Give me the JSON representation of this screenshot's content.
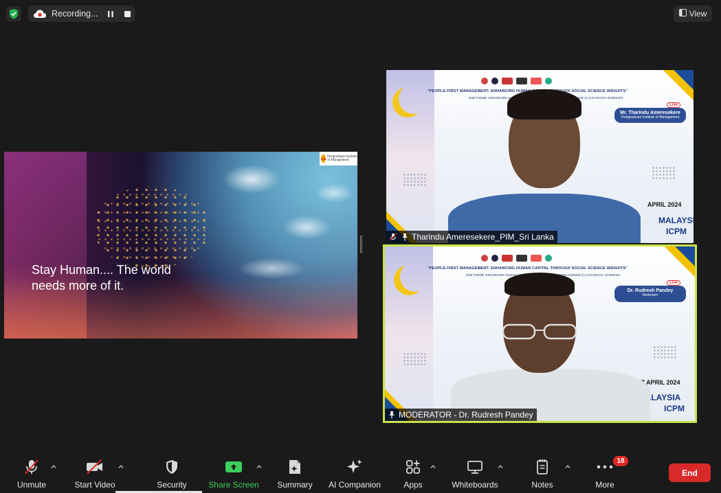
{
  "topbar": {
    "recording_label": "Recording...",
    "view_label": "View"
  },
  "share": {
    "quote": "Stay Human.... The world needs more of it.",
    "logo_text": "Postgraduate Institute of Management",
    "logo_mark": "PIM"
  },
  "tiles": [
    {
      "participant_name": "Tharindu Ameresekere_PIM_Sri Lanka",
      "muted": true,
      "banner_headline": "\"PEOPLE-FIRST MANAGEMENT: ENHANCING HUMAN CAPITAL THROUGH SOCIAL SCIENCE INSIGHTS\"",
      "banner_sub": "SUB THEME: ENHANCING HUMAN CAPITAL USING ARTIFICIAL INTELLIGENCE (A.I) IN SOCIAL SCIENCES",
      "nameplate_name": "Mr. Tharindu Ameresekere",
      "nameplate_org": "Postgraduate Institute of Management",
      "live": "Live",
      "date": "APRIL 2024",
      "location": "MALAYSIA",
      "event": "ICPM"
    },
    {
      "participant_name": "MODERATOR - Dr. Rudresh Pandey",
      "muted": false,
      "active_speaker": true,
      "banner_headline": "\"PEOPLE-FIRST MANAGEMENT: ENHANCING HUMAN CAPITAL THROUGH SOCIAL SCIENCE INSIGHTS\"",
      "banner_sub": "SUB THEME: ENHANCING HUMAN CAPITAL USING ARTIFICIAL INTELLIGENCE (A.I) IN SOCIAL SCIENCES",
      "nameplate_name": "Dr. Rudresh Pandey",
      "nameplate_org": "Moderator",
      "live": "Live",
      "date": "26 - 27 APRIL 2024",
      "location": "24 MALAYSIA",
      "event": "ICPM"
    }
  ],
  "toolbar": {
    "unmute": "Unmute",
    "start_video": "Start Video",
    "security": "Security",
    "share_screen": "Share Screen",
    "summary": "Summary",
    "ai_companion": "AI Companion",
    "apps": "Apps",
    "whiteboards": "Whiteboards",
    "notes": "Notes",
    "more": "More",
    "more_badge": "18",
    "end": "End"
  },
  "colors": {
    "background": "#1a1a1a",
    "active_speaker_border": "#c8e24a",
    "share_green": "#3ccf5e",
    "end_red": "#d92a2a"
  },
  "icons": [
    "shield-check-icon",
    "cloud-record-icon",
    "pause-icon",
    "stop-icon",
    "view-icon",
    "mic-muted-icon",
    "video-muted-icon",
    "security-shield-icon",
    "share-screen-icon",
    "summary-icon",
    "ai-companion-icon",
    "apps-icon",
    "whiteboards-icon",
    "notes-icon",
    "more-icon"
  ]
}
